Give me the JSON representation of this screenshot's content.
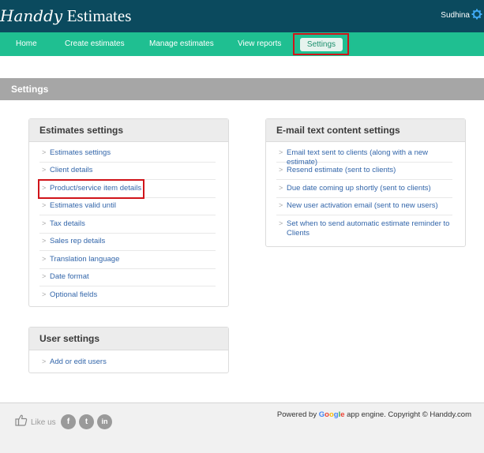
{
  "header": {
    "logo_script": "Handdy",
    "logo_text": "Estimates",
    "user_name": "Sudhina",
    "bg_color": "#0b4a5e"
  },
  "nav": {
    "items": [
      "Home",
      "Create estimates",
      "Manage estimates",
      "View reports",
      "Settings"
    ],
    "active_index": 4,
    "bg_color": "#1fbf91"
  },
  "page": {
    "title": "Settings"
  },
  "estimates_panel": {
    "title": "Estimates settings",
    "items": [
      "Estimates settings",
      "Client details",
      "Product/service item details",
      "Estimates valid until",
      "Tax details",
      "Sales rep details",
      "Translation language",
      "Date format",
      "Optional fields"
    ]
  },
  "user_panel": {
    "title": "User settings",
    "items": [
      "Add or edit users"
    ]
  },
  "email_panel": {
    "title": "E-mail text content settings",
    "items": [
      "Email text sent to clients (along with a new estimate)",
      "Resend estimate (sent to clients)",
      "Due date coming up shortly (sent to clients)",
      "New user activation email (sent to new users)",
      "Set when to send automatic estimate reminder to Clients"
    ]
  },
  "footer": {
    "like_text": "Like us",
    "social_icons": [
      "facebook-icon",
      "twitter-icon",
      "linkedin-icon"
    ],
    "powered_prefix": "Powered by",
    "google_letters": [
      "G",
      "o",
      "o",
      "g",
      "l",
      "e"
    ],
    "powered_suffix": "app engine. Copyright © Handdy.com"
  }
}
